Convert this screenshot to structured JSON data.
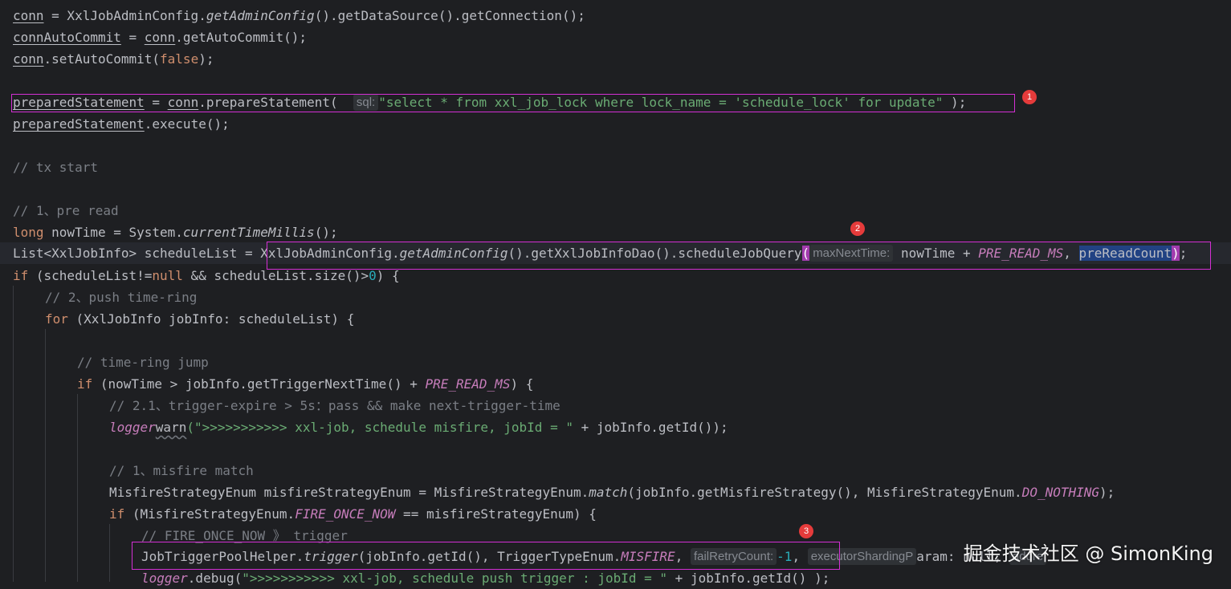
{
  "code": {
    "l1": {
      "a": "conn",
      "b": " = XxlJobAdminConfig.",
      "c": "getAdminConfig",
      "d": "().getDataSource().getConnection();"
    },
    "l2": {
      "a": "connAutoCommit",
      "b": " = ",
      "c": "conn",
      "d": ".getAutoCommit();"
    },
    "l3": {
      "a": "conn",
      "b": ".setAutoCommit(",
      "c": "false",
      "d": ");"
    },
    "l4": {
      "a": "preparedStatement",
      "b": " = ",
      "c": "conn",
      "d": ".prepareStatement( ",
      "hint": "sql:",
      "e": "\"select * from xxl_job_lock where lock_name = 'schedule_lock' for update\"",
      "f": " );"
    },
    "l5": {
      "a": "preparedStatement",
      "b": ".execute();"
    },
    "l6": "// tx start",
    "l7": "// 1、pre read",
    "l8": {
      "kw": "long",
      "b": " nowTime = System.",
      "c": "currentTimeMillis",
      "d": "();"
    },
    "l9": {
      "a": "List<XxlJobInfo> scheduleList = XxlJobAdminConfig.",
      "c": "getAdminConfig",
      "d": "().getXxlJobInfoDao().scheduleJobQuery",
      "p": "(",
      "hint": "maxNextTime:",
      "e": " nowTime + ",
      "f": "PRE_READ_MS",
      ",": ", ",
      "g": "preReadCount",
      "h": ")",
      "i": ";"
    },
    "l10": {
      "kw": "if",
      "b": " (scheduleList!=",
      "n": "null",
      "c": " && scheduleList.size()>",
      "num": "0",
      "d": ") {"
    },
    "l11": "// 2、push time-ring",
    "l12": {
      "kw": "for",
      "b": " (XxlJobInfo jobInfo: scheduleList) {"
    },
    "l13": "// time-ring jump",
    "l14": {
      "kw": "if",
      "b": " (nowTime > jobInfo.getTriggerNextTime() + ",
      "f": "PRE_READ_MS",
      "d": ") {"
    },
    "l15": "// 2.1、trigger-expire > 5s：pass && make next-trigger-time",
    "l16": {
      "a": "logger",
      ".": ".",
      "w": "warn",
      "s": "(\">>>>>>>>>>> xxl-job, schedule misfire, jobId = \"",
      "d": " + jobInfo.getId());"
    },
    "l17": "// 1、misfire match",
    "l18": {
      "a": "MisfireStrategyEnum misfireStrategyEnum = MisfireStrategyEnum.",
      "m": "match",
      "b": "(jobInfo.getMisfireStrategy(), MisfireStrategyEnum.",
      "f": "DO_NOTHING",
      "d": ");"
    },
    "l19": {
      "kw": "if",
      "b": " (MisfireStrategyEnum.",
      "f": "FIRE_ONCE_NOW",
      "d": " == misfireStrategyEnum) {"
    },
    "l20": "// FIRE_ONCE_NOW 》 trigger",
    "l21": {
      "a": "JobTriggerPoolHelper.",
      "t": "trigger",
      "b": "(jobInfo.getId(), TriggerTypeEnum.",
      "f": "MISFIRE",
      "c": ", ",
      "hint": "failRetryCount:",
      "num": "-1",
      ",": ", ",
      "hint2": "executorShardingP",
      "r": "aram: null,",
      "hint3": "addre"
    },
    "l22": {
      "a": "logger",
      "b": ".debug(",
      "s": "\">>>>>>>>>>> xxl-job, schedule push trigger : jobId = \"",
      "d": " + jobInfo.getId() );"
    }
  },
  "badges": [
    "1",
    "2",
    "3"
  ],
  "watermark": "掘金技术社区 @ SimonKing",
  "colors": {
    "background": "#1e1f22",
    "box": "#d42fd4",
    "badge": "#e53b3b",
    "keyword": "#cf8e6d",
    "string": "#6aab73",
    "constant": "#c77dbb",
    "comment": "#7a7e85"
  }
}
